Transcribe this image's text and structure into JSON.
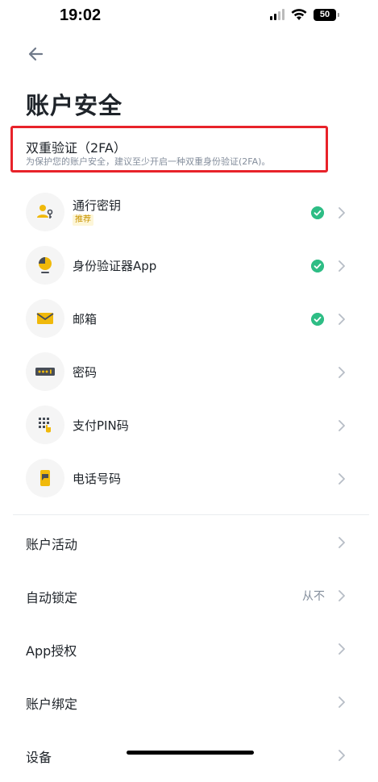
{
  "status_bar": {
    "time": "19:02",
    "battery": "50"
  },
  "page": {
    "title": "账户安全"
  },
  "twofa": {
    "title": "双重验证（2FA）",
    "description": "为保护您的账户安全，建议至少开启一种双重身份验证(2FA)。"
  },
  "methods": [
    {
      "label": "通行密钥",
      "tag": "推荐",
      "enabled": true,
      "icon": "passkey-icon"
    },
    {
      "label": "身份验证器App",
      "enabled": true,
      "icon": "authenticator-icon"
    },
    {
      "label": "邮箱",
      "enabled": true,
      "icon": "mail-icon"
    },
    {
      "label": "密码",
      "enabled": false,
      "icon": "password-icon"
    },
    {
      "label": "支付PIN码",
      "enabled": false,
      "icon": "pin-icon"
    },
    {
      "label": "电话号码",
      "enabled": false,
      "icon": "phone-icon"
    }
  ],
  "settings": [
    {
      "label": "账户活动"
    },
    {
      "label": "自动锁定",
      "value": "从不"
    },
    {
      "label": "App授权"
    },
    {
      "label": "账户绑定"
    },
    {
      "label": "设备"
    }
  ],
  "colors": {
    "accent": "#f0b90b",
    "check": "#2ebd85",
    "highlight_border": "#e8222a"
  }
}
